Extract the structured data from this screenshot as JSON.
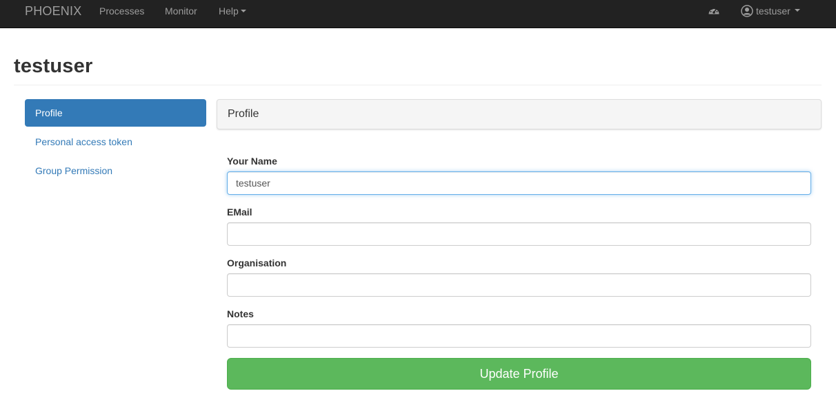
{
  "navbar": {
    "brand": "PHOENIX",
    "links": [
      "Processes",
      "Monitor",
      "Help"
    ],
    "dashboard_icon": "dashboard-icon",
    "user_icon": "user-circle-icon",
    "user_name": "testuser"
  },
  "page": {
    "title": "testuser"
  },
  "sidebar": {
    "items": [
      {
        "label": "Profile",
        "active": true
      },
      {
        "label": "Personal access token",
        "active": false
      },
      {
        "label": "Group Permission",
        "active": false
      }
    ]
  },
  "panel": {
    "heading": "Profile"
  },
  "form": {
    "name_label": "Your Name",
    "name_value": "testuser",
    "email_label": "EMail",
    "email_value": "",
    "organisation_label": "Organisation",
    "organisation_value": "",
    "notes_label": "Notes",
    "notes_value": "",
    "submit_label": "Update Profile"
  },
  "colors": {
    "navbar_bg": "#222222",
    "primary": "#337ab7",
    "success": "#5cb85c"
  }
}
